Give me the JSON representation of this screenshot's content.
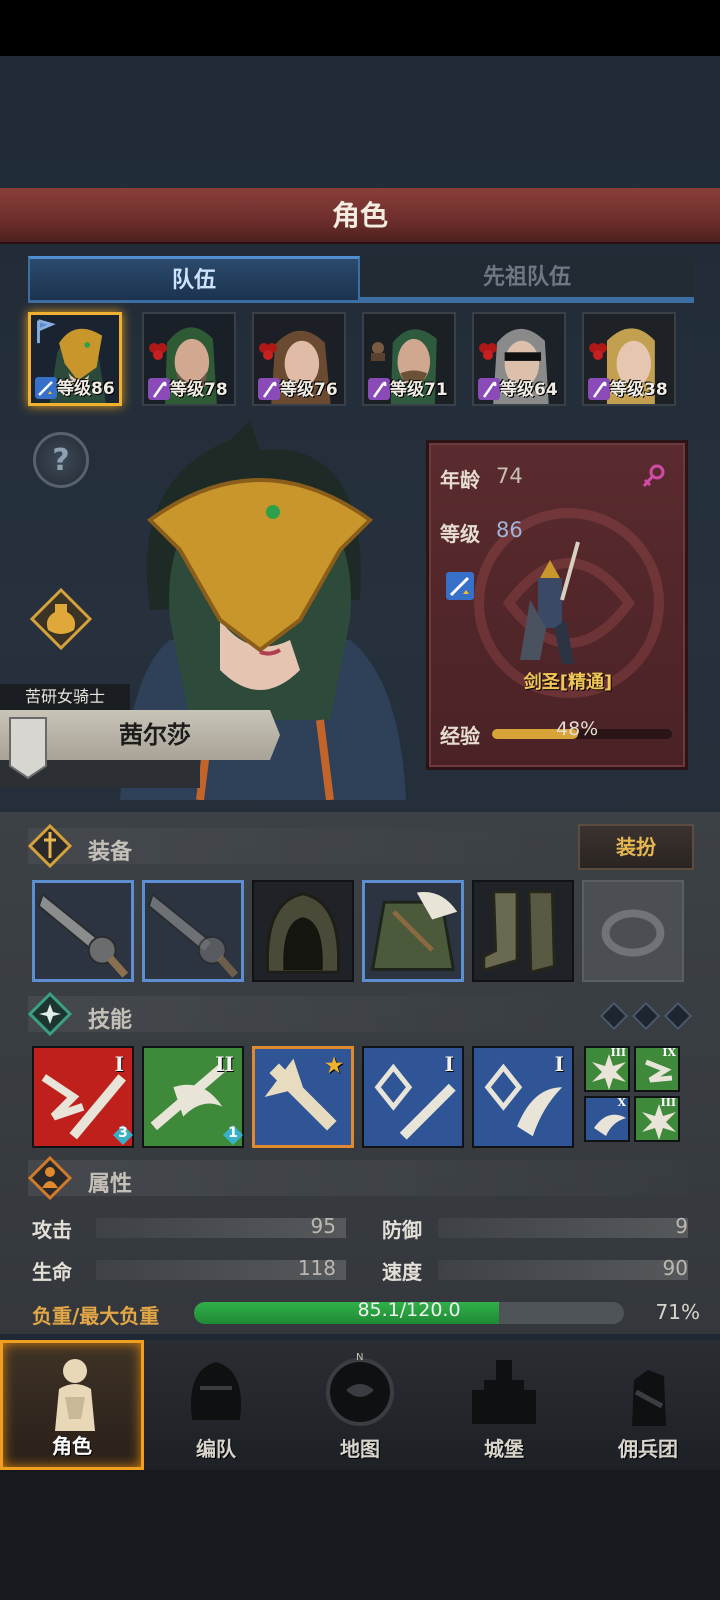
{
  "header": {
    "title": "角色"
  },
  "tabs": [
    {
      "label": "队伍",
      "active": true
    },
    {
      "label": "先祖队伍",
      "active": false
    }
  ],
  "roster": [
    {
      "level_label": "等级86",
      "selected": true
    },
    {
      "level_label": "等级78",
      "selected": false
    },
    {
      "level_label": "等级76",
      "selected": false
    },
    {
      "level_label": "等级71",
      "selected": false
    },
    {
      "level_label": "等级64",
      "selected": false
    },
    {
      "level_label": "等级38",
      "selected": false
    }
  ],
  "character": {
    "title": "苦研女骑士",
    "name": "茜尔莎",
    "age_label": "年龄",
    "age": "74",
    "level_label": "等级",
    "level": "86",
    "class_name": "剑圣[精通]",
    "exp_label": "经验",
    "exp_percent_text": "48%",
    "exp_fraction": 0.48
  },
  "equipment": {
    "title": "装备",
    "outfit_button": "装扮",
    "slots": [
      {
        "icon": "greatsword-icon",
        "rarity": "blue"
      },
      {
        "icon": "greatsword-icon",
        "rarity": "blue"
      },
      {
        "icon": "hood-icon",
        "rarity": "none"
      },
      {
        "icon": "fur-coat-icon",
        "rarity": "blue"
      },
      {
        "icon": "boots-icon",
        "rarity": "none"
      },
      {
        "icon": "ring-icon",
        "rarity": "empty"
      }
    ]
  },
  "skills": {
    "title": "技能",
    "items": [
      {
        "rank": "I",
        "gem": "3",
        "color": "#c0201c"
      },
      {
        "rank": "II",
        "gem": "1",
        "color": "#3e8a3a"
      },
      {
        "rank": "★",
        "gem": "",
        "color": "#2f5596"
      },
      {
        "rank": "I",
        "gem": "",
        "color": "#2f5596"
      },
      {
        "rank": "I",
        "gem": "",
        "color": "#2f5596"
      }
    ],
    "mini": [
      {
        "rank": "III",
        "color": "#3e8a3a"
      },
      {
        "rank": "IX",
        "color": "#3e8a3a"
      },
      {
        "rank": "X",
        "color": "#2f5596"
      },
      {
        "rank": "III",
        "color": "#3e8a3a"
      }
    ]
  },
  "attributes": {
    "title": "属性",
    "attack_label": "攻击",
    "attack": "95",
    "defense_label": "防御",
    "defense": "9",
    "hp_label": "生命",
    "hp": "118",
    "speed_label": "速度",
    "speed": "90",
    "load_label": "负重/最大负重",
    "load_value": "85.1/120.0",
    "load_percent": "71%",
    "load_fraction": 0.709
  },
  "nav": [
    {
      "label": "角色",
      "icon": "knight-icon",
      "active": true
    },
    {
      "label": "编队",
      "icon": "helmet-icon",
      "active": false
    },
    {
      "label": "地图",
      "icon": "compass-map-icon",
      "active": false
    },
    {
      "label": "城堡",
      "icon": "castle-icon",
      "active": false
    },
    {
      "label": "佣兵团",
      "icon": "mercenary-fist-icon",
      "active": false
    }
  ]
}
